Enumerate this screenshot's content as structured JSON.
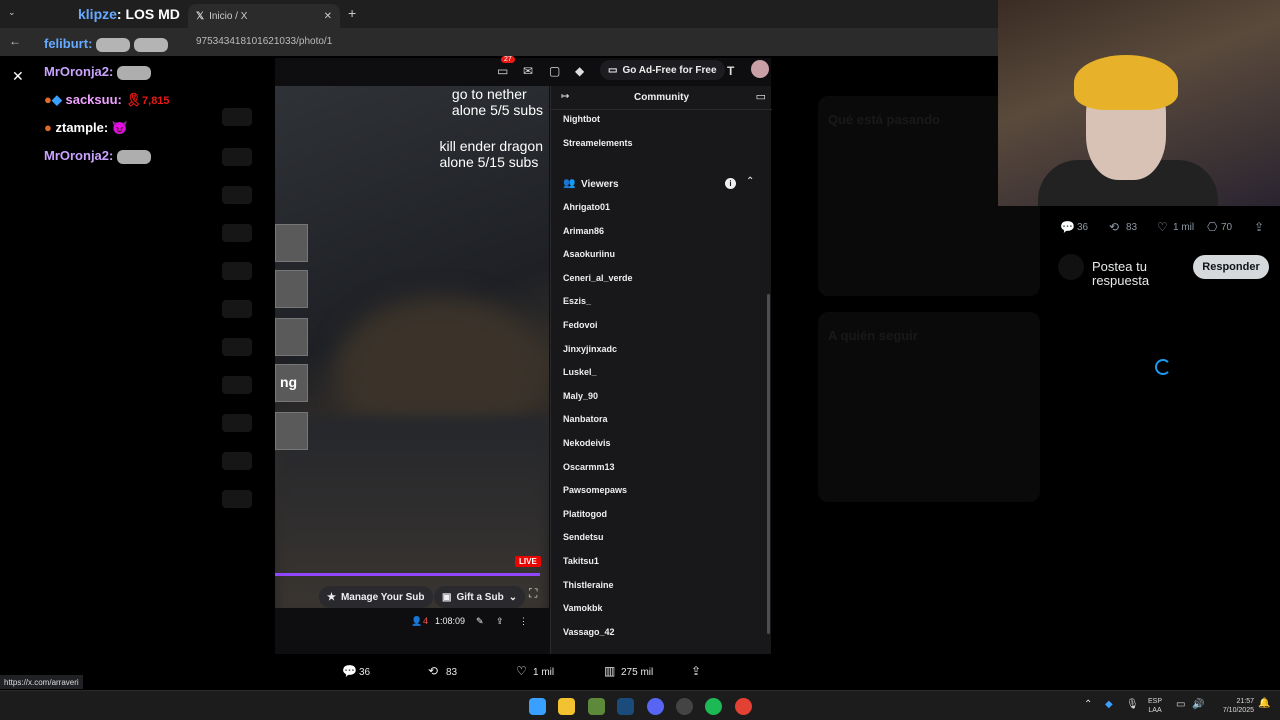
{
  "browser": {
    "tab_active_title": "Inicio / X",
    "url": "975343418101621033/photo/1",
    "new_tab": "+"
  },
  "chat": {
    "header_user": "klipze",
    "header_msg": ": LOS MD",
    "line2_user": "feliburt",
    "line2_msg": ":",
    "messages": [
      {
        "user": "MrOronja2",
        "text": ":",
        "color": "#c9a4ff"
      },
      {
        "user": "sacksuu",
        "text": ":",
        "color": "#f0a0ff",
        "badge_count": "7,815"
      },
      {
        "user": "ztample",
        "text": ":",
        "color": "#ffffff"
      },
      {
        "user": "MrOronja2",
        "text": ":",
        "color": "#c9a4ff"
      }
    ]
  },
  "stream": {
    "goal1_a": "go to nether",
    "goal1_b": "alone 5/5 subs",
    "goal2_a": "kill ender dragon",
    "goal2_b": "alone 5/15 subs",
    "side_label": "ng",
    "live_badge": "LIVE",
    "notif_count": "27",
    "ad_free_label": "Go Ad-Free for Free",
    "manage_sub": "Manage Your Sub",
    "gift_sub": "Gift a Sub",
    "viewer_count": "4",
    "uptime": "1:08:09"
  },
  "community": {
    "title": "Community",
    "bots": [
      "Nightbot",
      "Streamelements"
    ],
    "viewers_label": "Viewers",
    "viewers": [
      "Ahrigato01",
      "Ariman86",
      "Asaokuriinu",
      "Ceneri_al_verde",
      "Eszis_",
      "Fedovoi",
      "Jinxyjinxadc",
      "Luskel_",
      "Maly_90",
      "Nanbatora",
      "Nekodeivis",
      "Oscarmm13",
      "Pawsomepaws",
      "Platitogod",
      "Sendetsu",
      "Takitsu1",
      "Thistleraine",
      "Vamokbk",
      "Vassago_42"
    ]
  },
  "tweet": {
    "replies": "36",
    "retweets": "83",
    "likes": "1 mil",
    "bookmarks": "70",
    "views": "275 mil",
    "reply_placeholder": "Postea tu respuesta",
    "reply_button": "Responder"
  },
  "x_right": {
    "trending_title": "Qué está pasando",
    "follow_title": "A quién seguir"
  },
  "status_url": "https://x.com/arraveri",
  "taskbar": {
    "lang_top": "ESP",
    "lang_bottom": "LAA",
    "time": "21:57",
    "date": "7/10/2025"
  }
}
